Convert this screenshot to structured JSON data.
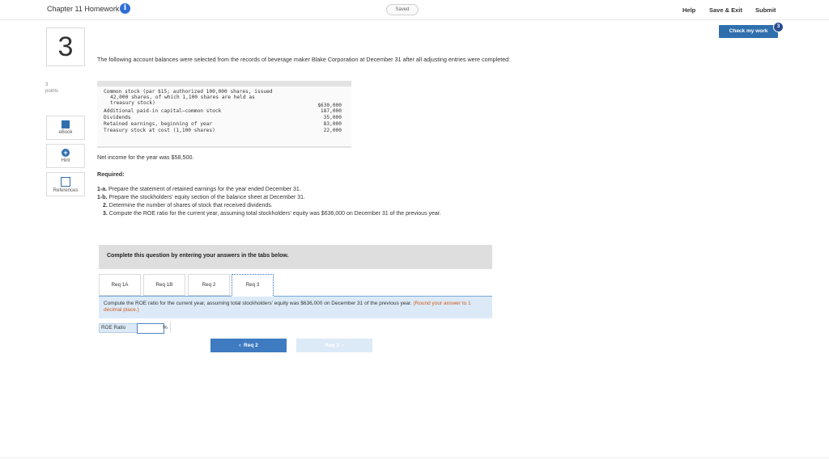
{
  "header": {
    "chapter_title": "Chapter 11 Homework",
    "info_icon": "i",
    "saved_label": "Saved",
    "help_label": "Help",
    "save_exit_label": "Save & Exit",
    "submit_label": "Submit",
    "check_label": "Check my work",
    "check_badge": "3"
  },
  "question": {
    "number": "3",
    "points_value": "3",
    "points_label": "points"
  },
  "side_tools": [
    {
      "label": "eBook",
      "icon": "ebook-icon"
    },
    {
      "label": "Hint",
      "icon": "hint-icon"
    },
    {
      "label": "References",
      "icon": "references-icon"
    }
  ],
  "problem": {
    "intro": "The following account balances were selected from the records of beverage maker Blake Corporation at December 31 after all adjusting entries were completed:",
    "accounts": [
      {
        "line1": "Common stock (par $15; authorized 100,000 shares, issued",
        "line2": "42,000 shares, of which 1,100 shares are held as",
        "line3": "treasury stock)",
        "value": "$630,000"
      },
      {
        "name": "Additional paid-in capital–common stock",
        "value": "187,000"
      },
      {
        "name": "Dividends",
        "value": "35,000"
      },
      {
        "name": "Retained earnings, beginning of year",
        "value": "83,000"
      },
      {
        "name": "Treasury stock at cost (1,100 shares)",
        "value": "22,000"
      }
    ],
    "net_income": "Net income for the year was $58,500.",
    "required_label": "Required:",
    "requirements": [
      {
        "label": "1-a.",
        "text": "Prepare the statement of retained earnings for the year ended December 31."
      },
      {
        "label": "1-b.",
        "text": "Prepare the stockholders' equity section of the balance sheet at December 31."
      },
      {
        "label": "2.",
        "text": "Determine the number of shares of stock that received dividends."
      },
      {
        "label": "3.",
        "text": "Compute the ROE ratio for the current year, assuming total stockholders' equity was $636,000 on December 31 of the previous year."
      }
    ]
  },
  "answer_panel": {
    "header": "Complete this question by entering your answers in the tabs below.",
    "tabs": [
      "Req 1A",
      "Req 1B",
      "Req 2",
      "Req 3"
    ],
    "active_tab": "Req 3",
    "instruction": "Compute the ROE ratio for the current year, assuming total stockholders' equity was $636,000 on December 31 of the previous year.",
    "instruction_note": "(Round your answer to 1 decimal place.)",
    "roe_label": "ROE Ratio",
    "roe_value": "",
    "roe_unit": "%"
  },
  "navigation": {
    "prev_label": "Req 2",
    "next_label": "Req 3"
  },
  "colors": {
    "primary": "#2f6fae",
    "nav_prev": "#3f7bc1",
    "nav_next_disabled": "#dce9f7",
    "instruction_bg": "#dceaf7",
    "note_orange": "#d05a1b"
  }
}
